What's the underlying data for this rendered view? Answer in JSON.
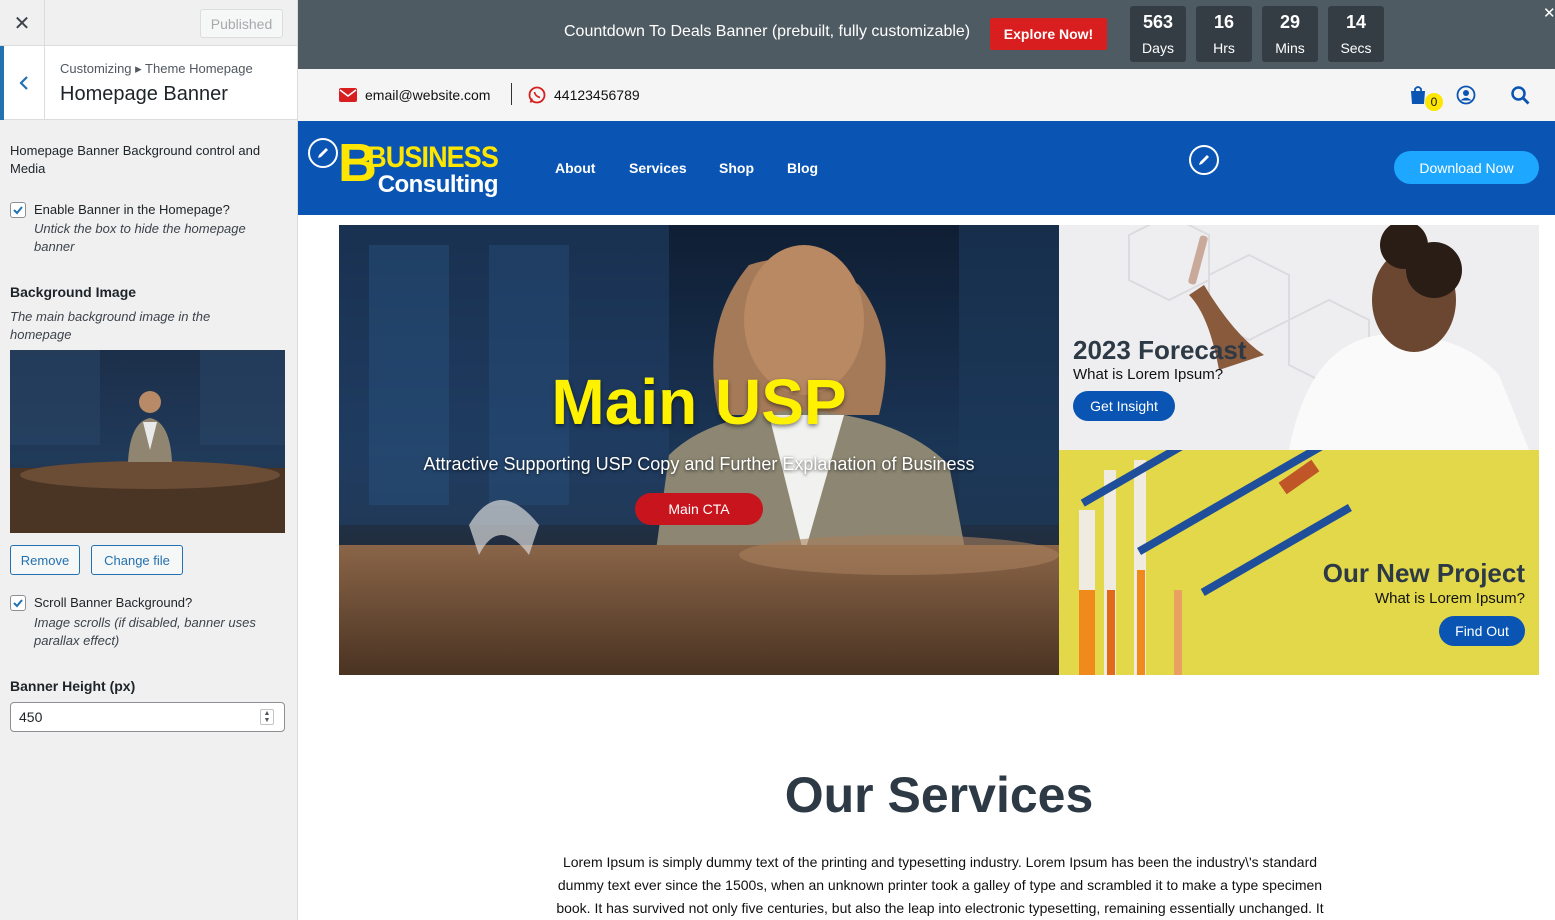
{
  "sidebar": {
    "close_icon": "close-icon",
    "published_label": "Published",
    "breadcrumb": "Customizing ▸ Theme Homepage",
    "section_title": "Homepage Banner",
    "intro": "Homepage Banner Background control and Media",
    "enable_banner": {
      "label": "Enable Banner in the Homepage?",
      "description": "Untick the box to hide the homepage banner",
      "checked": true
    },
    "background_image": {
      "heading": "Background Image",
      "description": "The main background image in the homepage",
      "remove_label": "Remove",
      "change_label": "Change file"
    },
    "scroll_banner": {
      "label": "Scroll Banner Background?",
      "description": "Image scrolls (if disabled, banner uses parallax effect)",
      "checked": true
    },
    "banner_height": {
      "label": "Banner Height (px)",
      "value": "450"
    }
  },
  "preview": {
    "countdown": {
      "text": "Countdown To Deals Banner (prebuilt, fully customizable)",
      "button_label": "Explore Now!",
      "units": [
        {
          "value": "563",
          "label": "Days"
        },
        {
          "value": "16",
          "label": "Hrs"
        },
        {
          "value": "29",
          "label": "Mins"
        },
        {
          "value": "14",
          "label": "Secs"
        }
      ]
    },
    "contact": {
      "email": "email@website.com",
      "phone": "44123456789",
      "cart_count": "0"
    },
    "nav": {
      "logo_line1": "BUSINESS",
      "logo_line2": "Consulting",
      "links": [
        "About",
        "Services",
        "Shop",
        "Blog"
      ],
      "download_label": "Download Now"
    },
    "banner": {
      "title": "Main USP",
      "subtitle": "Attractive Supporting USP Copy and Further Explanation of Business",
      "cta_label": "Main CTA"
    },
    "forecast": {
      "title": "2023 Forecast",
      "subtitle": "What is Lorem Ipsum?",
      "button_label": "Get Insight"
    },
    "project": {
      "title": "Our New Project",
      "subtitle": "What is Lorem Ipsum?",
      "button_label": "Find Out"
    },
    "services": {
      "title": "Our Services",
      "text": "Lorem Ipsum is simply dummy text of the printing and typesetting industry. Lorem Ipsum has been the industry\\'s standard dummy text ever since the 1500s, when an unknown printer took a galley of type and scrambled it to make a type specimen book. It has survived not only five centuries, but also the leap into electronic typesetting, remaining essentially unchanged. It"
    }
  },
  "colors": {
    "countdown_bg": "#4f5b62",
    "explore_red": "#d81e1e",
    "nav_blue": "#0a55b3",
    "download_blue": "#1ea7ff",
    "usp_yellow": "#fff200",
    "cta_red": "#c8141c"
  }
}
